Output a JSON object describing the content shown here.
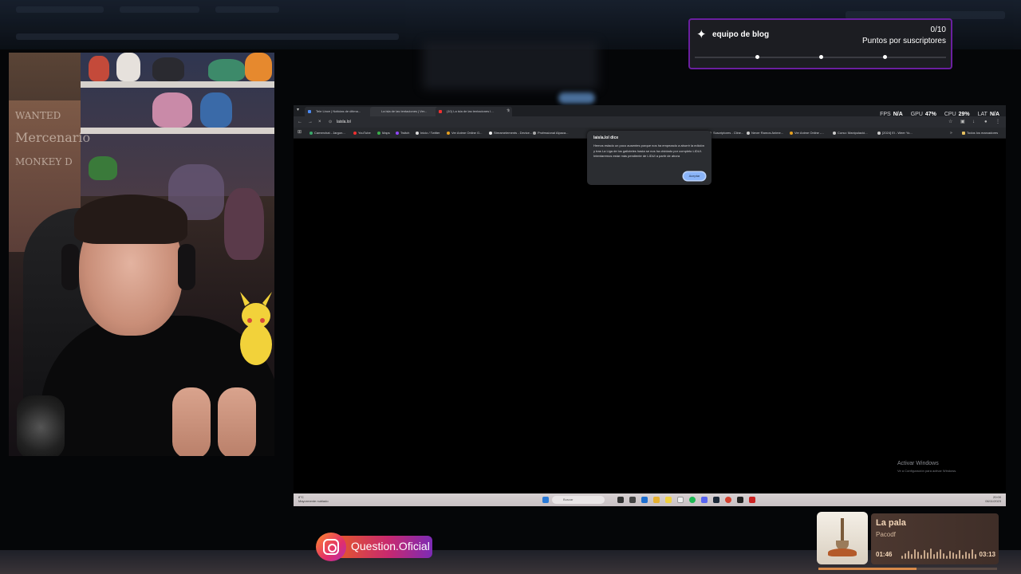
{
  "goal": {
    "title": "equipo de blog",
    "count": "0/10",
    "label": "Puntos por suscriptores",
    "icon": "star-badge-icon",
    "border_color": "#6a1fa0"
  },
  "browser": {
    "tabs": [
      {
        "label": "Tele Lince | Noticias de última..."
      },
      {
        "label": "La isla de las tentaciones | Ver..."
      },
      {
        "label": "(10) La isla de las tentaciones I..."
      }
    ],
    "new_tab_label": "+",
    "url": "laisla.lol",
    "bookmarks": [
      {
        "label": "Camerchat - Jargon..."
      },
      {
        "label": "YouTube"
      },
      {
        "label": "Maps"
      },
      {
        "label": "Twitch"
      },
      {
        "label": "Inicio / Twitter"
      },
      {
        "label": "Ver Anime Online G..."
      },
      {
        "label": "Streamelements - Device..."
      },
      {
        "label": "Professional Alpaca..."
      },
      {
        "label": "Suscriptores - Cline..."
      },
      {
        "label": "Never Ramos Anime..."
      },
      {
        "label": "Ver Anime Online -..."
      },
      {
        "label": "Curso: Manipulació..."
      },
      {
        "label": "[2024] El - Weer Yo..."
      }
    ],
    "other_bookmarks": "Todos los marcadores"
  },
  "stats": {
    "fps_label": "FPS",
    "fps": "N/A",
    "gpu_label": "GPU",
    "gpu": "47%",
    "cpu_label": "CPU",
    "cpu": "29%",
    "lat_label": "LAT",
    "lat": "N/A"
  },
  "dialog": {
    "title": "laisla.lol dice",
    "message": "Hemos estado un poco ausentes porque nos ha empezado a aburrir la edición y tras La Liga de los galloteles hasta se nos ha olvidado por completo LIDUI. Intentaremos estar más pendiente de LIDUI a partir de ahora",
    "button": "Aceptar"
  },
  "windows": {
    "activate_title": "Activar Windows",
    "activate_sub": "Ve a Configuración para activar Windows.",
    "weather": "8°C",
    "weather_desc": "Mayormente nublado",
    "search_placeholder": "Buscar",
    "time": "20:00",
    "date": "06/11/2023",
    "lang": "ESP"
  },
  "instagram": {
    "handle": "Question.Oficial",
    "icon": "instagram-icon"
  },
  "music": {
    "title": "La pala",
    "artist": "Pacodf",
    "elapsed": "01:46",
    "total": "03:13",
    "progress": 0.55,
    "art_icon": "shovel-icon"
  },
  "webcam": {
    "poster_text": [
      "WANTED",
      "Mercenario",
      "MONKEY D"
    ]
  }
}
